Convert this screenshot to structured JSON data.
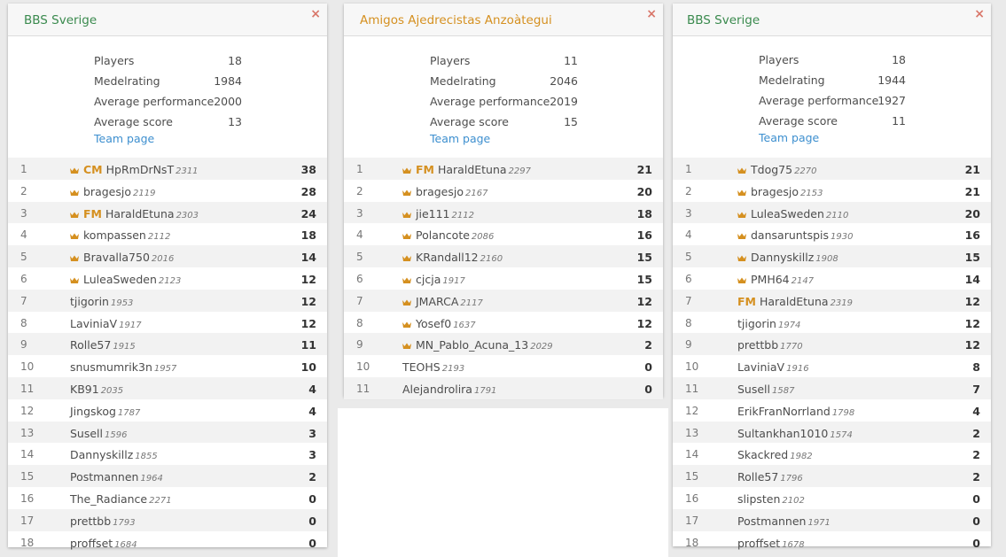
{
  "colors": {
    "title_green": "#3a8a4e",
    "title_orange": "#d59020",
    "link_blue": "#3d8fcf",
    "close_red": "#d9776a"
  },
  "stat_labels": {
    "players": "Players",
    "rating": "Medelrating",
    "performance": "Average performance",
    "score": "Average score",
    "team_page": "Team page"
  },
  "close_icon": "×",
  "teams": [
    {
      "name": "BBS Sverige",
      "players": "18",
      "rating": "1984",
      "performance": "2000",
      "score": "13",
      "rows": [
        {
          "rank": "1",
          "crown": true,
          "title": "CM",
          "name": "HpRmDrNsT",
          "rating": "2311",
          "score": "38"
        },
        {
          "rank": "2",
          "crown": true,
          "title": "",
          "name": "bragesjo",
          "rating": "2119",
          "score": "28"
        },
        {
          "rank": "3",
          "crown": true,
          "title": "FM",
          "name": "HaraldEtuna",
          "rating": "2303",
          "score": "24"
        },
        {
          "rank": "4",
          "crown": true,
          "title": "",
          "name": "kompassen",
          "rating": "2112",
          "score": "18"
        },
        {
          "rank": "5",
          "crown": true,
          "title": "",
          "name": "Bravalla750",
          "rating": "2016",
          "score": "14"
        },
        {
          "rank": "6",
          "crown": true,
          "title": "",
          "name": "LuleaSweden",
          "rating": "2123",
          "score": "12"
        },
        {
          "rank": "7",
          "crown": false,
          "title": "",
          "name": "tjigorin",
          "rating": "1953",
          "score": "12"
        },
        {
          "rank": "8",
          "crown": false,
          "title": "",
          "name": "LaviniaV",
          "rating": "1917",
          "score": "12"
        },
        {
          "rank": "9",
          "crown": false,
          "title": "",
          "name": "Rolle57",
          "rating": "1915",
          "score": "11"
        },
        {
          "rank": "10",
          "crown": false,
          "title": "",
          "name": "snusmumrik3n",
          "rating": "1957",
          "score": "10"
        },
        {
          "rank": "11",
          "crown": false,
          "title": "",
          "name": "KB91",
          "rating": "2035",
          "score": "4"
        },
        {
          "rank": "12",
          "crown": false,
          "title": "",
          "name": "Jingskog",
          "rating": "1787",
          "score": "4"
        },
        {
          "rank": "13",
          "crown": false,
          "title": "",
          "name": "Susell",
          "rating": "1596",
          "score": "3"
        },
        {
          "rank": "14",
          "crown": false,
          "title": "",
          "name": "Dannyskillz",
          "rating": "1855",
          "score": "3"
        },
        {
          "rank": "15",
          "crown": false,
          "title": "",
          "name": "Postmannen",
          "rating": "1964",
          "score": "2"
        },
        {
          "rank": "16",
          "crown": false,
          "title": "",
          "name": "The_Radiance",
          "rating": "2271",
          "score": "0"
        },
        {
          "rank": "17",
          "crown": false,
          "title": "",
          "name": "prettbb",
          "rating": "1793",
          "score": "0"
        },
        {
          "rank": "18",
          "crown": false,
          "title": "",
          "name": "proffset",
          "rating": "1684",
          "score": "0"
        }
      ]
    },
    {
      "name": "Amigos Ajedrecistas Anzoàtegui",
      "players": "11",
      "rating": "2046",
      "performance": "2019",
      "score": "15",
      "rows": [
        {
          "rank": "1",
          "crown": true,
          "title": "FM",
          "name": "HaraldEtuna",
          "rating": "2297",
          "score": "21"
        },
        {
          "rank": "2",
          "crown": true,
          "title": "",
          "name": "bragesjo",
          "rating": "2167",
          "score": "20"
        },
        {
          "rank": "3",
          "crown": true,
          "title": "",
          "name": "jie111",
          "rating": "2112",
          "score": "18"
        },
        {
          "rank": "4",
          "crown": true,
          "title": "",
          "name": "Polancote",
          "rating": "2086",
          "score": "16"
        },
        {
          "rank": "5",
          "crown": true,
          "title": "",
          "name": "KRandall12",
          "rating": "2160",
          "score": "15"
        },
        {
          "rank": "6",
          "crown": true,
          "title": "",
          "name": "cjcja",
          "rating": "1917",
          "score": "15"
        },
        {
          "rank": "7",
          "crown": true,
          "title": "",
          "name": "JMARCA",
          "rating": "2117",
          "score": "12"
        },
        {
          "rank": "8",
          "crown": true,
          "title": "",
          "name": "Yosef0",
          "rating": "1637",
          "score": "12"
        },
        {
          "rank": "9",
          "crown": true,
          "title": "",
          "name": "MN_Pablo_Acuna_13",
          "rating": "2029",
          "score": "2"
        },
        {
          "rank": "10",
          "crown": false,
          "title": "",
          "name": "TEOHS",
          "rating": "2193",
          "score": "0"
        },
        {
          "rank": "11",
          "crown": false,
          "title": "",
          "name": "Alejandrolira",
          "rating": "1791",
          "score": "0"
        }
      ]
    },
    {
      "name": "BBS Sverige",
      "players": "18",
      "rating": "1944",
      "performance": "1927",
      "score": "11",
      "rows": [
        {
          "rank": "1",
          "crown": true,
          "title": "",
          "name": "Tdog75",
          "rating": "2270",
          "score": "21"
        },
        {
          "rank": "2",
          "crown": true,
          "title": "",
          "name": "bragesjo",
          "rating": "2153",
          "score": "21"
        },
        {
          "rank": "3",
          "crown": true,
          "title": "",
          "name": "LuleaSweden",
          "rating": "2110",
          "score": "20"
        },
        {
          "rank": "4",
          "crown": true,
          "title": "",
          "name": "dansaruntspis",
          "rating": "1930",
          "score": "16"
        },
        {
          "rank": "5",
          "crown": true,
          "title": "",
          "name": "Dannyskillz",
          "rating": "1908",
          "score": "15"
        },
        {
          "rank": "6",
          "crown": true,
          "title": "",
          "name": "PMH64",
          "rating": "2147",
          "score": "14"
        },
        {
          "rank": "7",
          "crown": false,
          "title": "FM",
          "name": "HaraldEtuna",
          "rating": "2319",
          "score": "12"
        },
        {
          "rank": "8",
          "crown": false,
          "title": "",
          "name": "tjigorin",
          "rating": "1974",
          "score": "12"
        },
        {
          "rank": "9",
          "crown": false,
          "title": "",
          "name": "prettbb",
          "rating": "1770",
          "score": "12"
        },
        {
          "rank": "10",
          "crown": false,
          "title": "",
          "name": "LaviniaV",
          "rating": "1916",
          "score": "8"
        },
        {
          "rank": "11",
          "crown": false,
          "title": "",
          "name": "Susell",
          "rating": "1587",
          "score": "7"
        },
        {
          "rank": "12",
          "crown": false,
          "title": "",
          "name": "ErikFranNorrland",
          "rating": "1798",
          "score": "4"
        },
        {
          "rank": "13",
          "crown": false,
          "title": "",
          "name": "Sultankhan1010",
          "rating": "1574",
          "score": "2"
        },
        {
          "rank": "14",
          "crown": false,
          "title": "",
          "name": "Skackred",
          "rating": "1982",
          "score": "2"
        },
        {
          "rank": "15",
          "crown": false,
          "title": "",
          "name": "Rolle57",
          "rating": "1796",
          "score": "2"
        },
        {
          "rank": "16",
          "crown": false,
          "title": "",
          "name": "slipsten",
          "rating": "2102",
          "score": "0"
        },
        {
          "rank": "17",
          "crown": false,
          "title": "",
          "name": "Postmannen",
          "rating": "1971",
          "score": "0"
        },
        {
          "rank": "18",
          "crown": false,
          "title": "",
          "name": "proffset",
          "rating": "1678",
          "score": "0"
        }
      ]
    }
  ]
}
